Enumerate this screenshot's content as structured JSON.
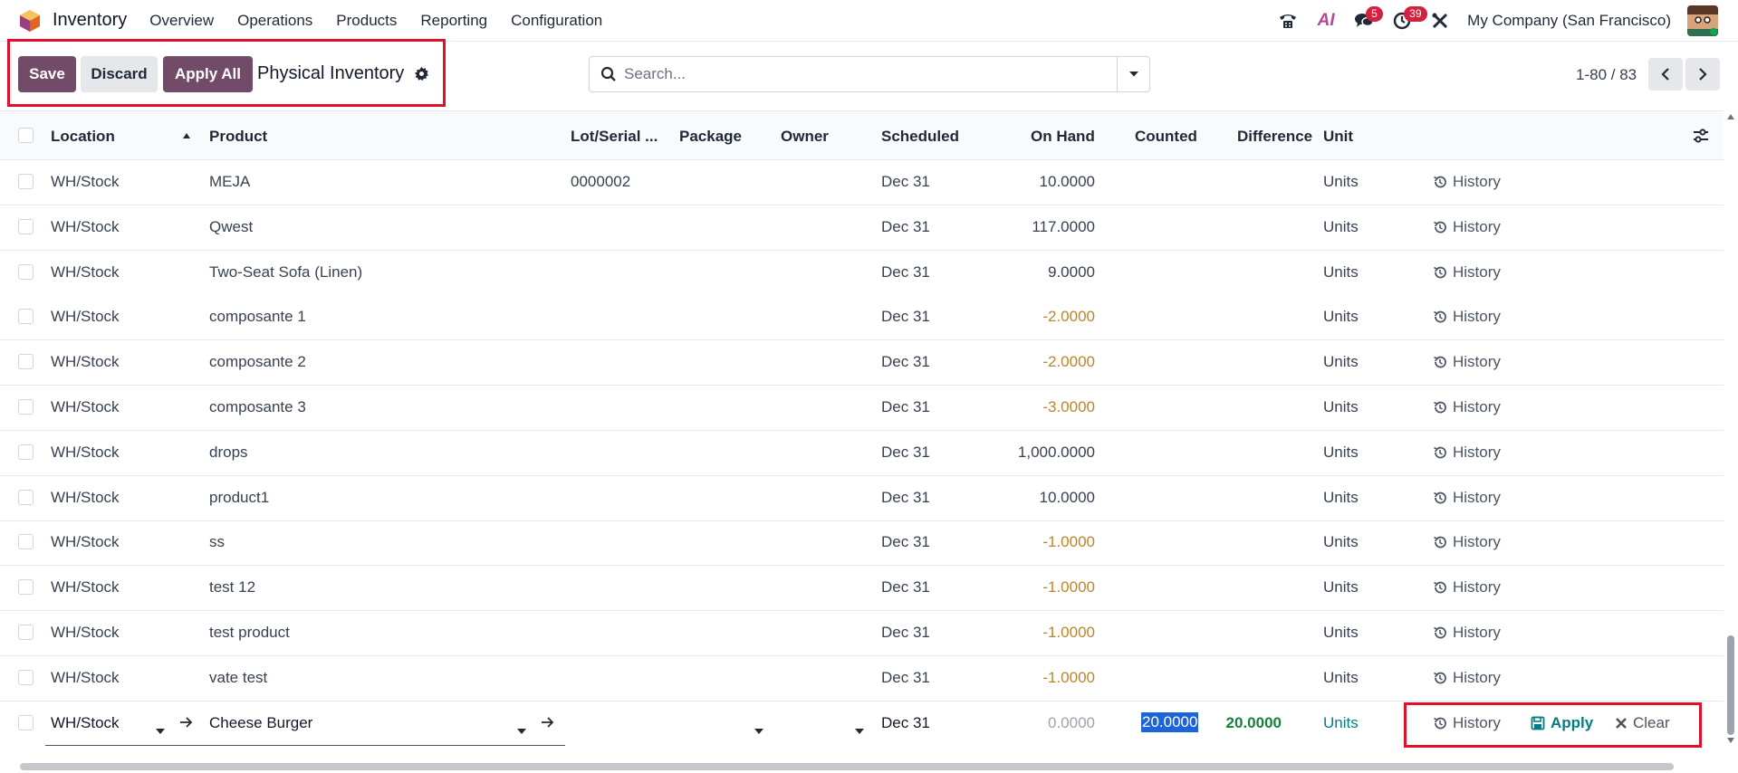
{
  "app": {
    "name": "Inventory"
  },
  "nav": {
    "menus": [
      "Overview",
      "Operations",
      "Products",
      "Reporting",
      "Configuration"
    ]
  },
  "systray": {
    "messages_count": "5",
    "activities_count": "39",
    "company": "My Company (San Francisco)",
    "ai_label": "AI"
  },
  "toolbar": {
    "save_label": "Save",
    "discard_label": "Discard",
    "apply_all_label": "Apply All",
    "title": "Physical Inventory"
  },
  "search": {
    "placeholder": "Search..."
  },
  "pager": {
    "value": "1-80 / 83"
  },
  "table": {
    "headers": {
      "location": "Location",
      "product": "Product",
      "lot": "Lot/Serial ...",
      "package": "Package",
      "owner": "Owner",
      "scheduled": "Scheduled",
      "on_hand": "On Hand",
      "counted": "Counted",
      "difference": "Difference",
      "unit": "Unit"
    },
    "history_label": "History",
    "rows": [
      {
        "location": "WH/Stock",
        "product": "MEJA",
        "lot": "0000002",
        "scheduled": "Dec 31",
        "on_hand": "10.0000",
        "unit": "Units",
        "negative": false
      },
      {
        "location": "WH/Stock",
        "product": "Qwest",
        "lot": "",
        "scheduled": "Dec 31",
        "on_hand": "117.0000",
        "unit": "Units",
        "negative": false
      },
      {
        "location": "WH/Stock",
        "product": "Two-Seat Sofa (Linen)",
        "lot": "",
        "scheduled": "Dec 31",
        "on_hand": "9.0000",
        "unit": "Units",
        "negative": false
      },
      {
        "location": "WH/Stock",
        "product": "composante 1",
        "lot": "",
        "scheduled": "Dec 31",
        "on_hand": "-2.0000",
        "unit": "Units",
        "negative": true
      },
      {
        "location": "WH/Stock",
        "product": "composante 2",
        "lot": "",
        "scheduled": "Dec 31",
        "on_hand": "-2.0000",
        "unit": "Units",
        "negative": true
      },
      {
        "location": "WH/Stock",
        "product": "composante 3",
        "lot": "",
        "scheduled": "Dec 31",
        "on_hand": "-3.0000",
        "unit": "Units",
        "negative": true
      },
      {
        "location": "WH/Stock",
        "product": "drops",
        "lot": "",
        "scheduled": "Dec 31",
        "on_hand": "1,000.0000",
        "unit": "Units",
        "negative": false
      },
      {
        "location": "WH/Stock",
        "product": "product1",
        "lot": "",
        "scheduled": "Dec 31",
        "on_hand": "10.0000",
        "unit": "Units",
        "negative": false
      },
      {
        "location": "WH/Stock",
        "product": "ss",
        "lot": "",
        "scheduled": "Dec 31",
        "on_hand": "-1.0000",
        "unit": "Units",
        "negative": true
      },
      {
        "location": "WH/Stock",
        "product": "test 12",
        "lot": "",
        "scheduled": "Dec 31",
        "on_hand": "-1.0000",
        "unit": "Units",
        "negative": true
      },
      {
        "location": "WH/Stock",
        "product": "test product",
        "lot": "",
        "scheduled": "Dec 31",
        "on_hand": "-1.0000",
        "unit": "Units",
        "negative": true
      },
      {
        "location": "WH/Stock",
        "product": "vate test",
        "lot": "",
        "scheduled": "Dec 31",
        "on_hand": "-1.0000",
        "unit": "Units",
        "negative": true
      }
    ],
    "edit_row": {
      "location": "WH/Stock",
      "product": "Cheese Burger",
      "scheduled": "Dec 31",
      "on_hand": "0.0000",
      "counted": "20.0000",
      "difference": "20.0000",
      "unit": "Units",
      "history_label": "History",
      "apply_label": "Apply",
      "clear_label": "Clear"
    }
  },
  "colors": {
    "primary": "#714b67",
    "negative": "#b9862c",
    "positive": "#16803c",
    "link": "#017e84",
    "highlight": "#e0102a"
  }
}
